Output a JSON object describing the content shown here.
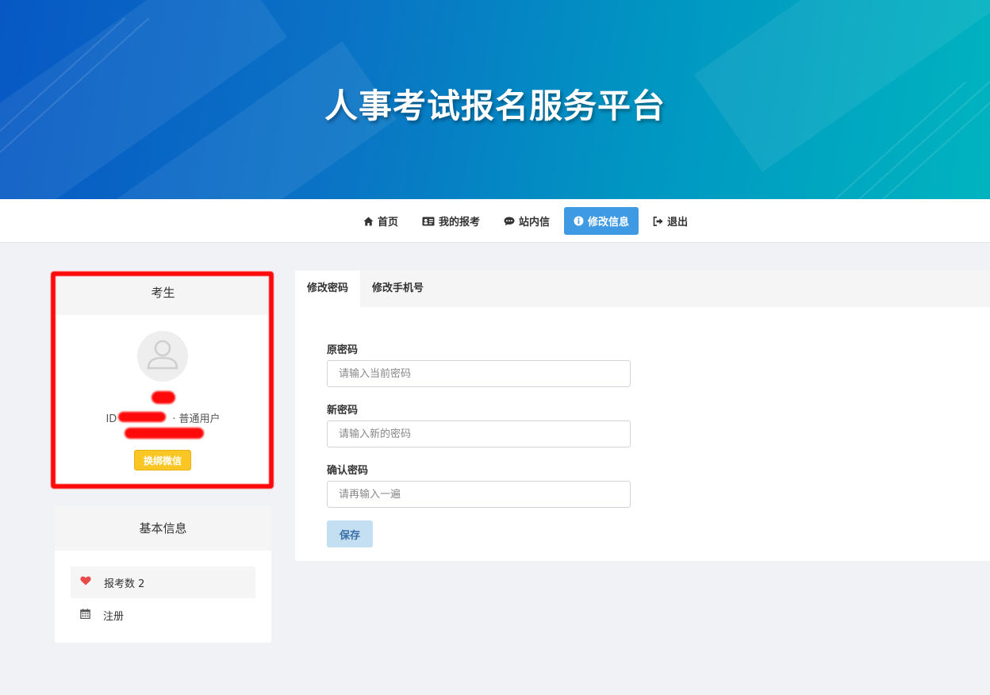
{
  "header": {
    "title": "人事考试报名服务平台"
  },
  "nav": {
    "items": [
      {
        "label": "首页",
        "icon": "home-icon"
      },
      {
        "label": "我的报考",
        "icon": "id-card-icon"
      },
      {
        "label": "站内信",
        "icon": "comment-icon"
      },
      {
        "label": "修改信息",
        "icon": "info-circle-icon",
        "active": true
      },
      {
        "label": "退出",
        "icon": "sign-out-icon"
      }
    ]
  },
  "profile": {
    "title": "考生",
    "id_prefix": "ID",
    "role": "· 普通用户",
    "wechat_button": "换绑微信"
  },
  "basic_info": {
    "title": "基本信息",
    "rows": [
      {
        "label": "报考数 2",
        "icon": "heart-icon"
      },
      {
        "label": "注册",
        "icon": "calendar-icon"
      }
    ]
  },
  "form": {
    "tabs": [
      "修改密码",
      "修改手机号"
    ],
    "fields": [
      {
        "label": "原密码",
        "placeholder": "请输入当前密码"
      },
      {
        "label": "新密码",
        "placeholder": "请输入新的密码"
      },
      {
        "label": "确认密码",
        "placeholder": "请再输入一遍"
      }
    ],
    "save_label": "保存"
  },
  "colors": {
    "nav_active": "#3f9ae4",
    "wechat_button": "#f9c623",
    "annotation_red": "#ff0a0a",
    "save_button": "#c4def2"
  }
}
